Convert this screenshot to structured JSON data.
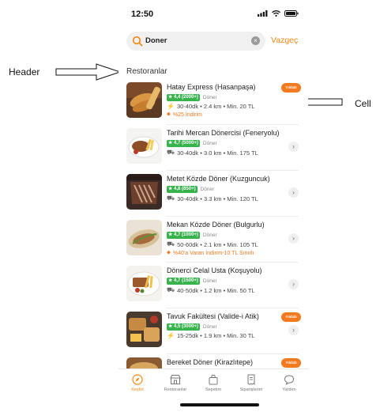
{
  "annotations": {
    "header_label": "Header",
    "cell_label": "Cell"
  },
  "status_bar": {
    "time": "12:50"
  },
  "search": {
    "query": "Doner",
    "cancel_label": "Vazgeç"
  },
  "section_title": "Restoranlar",
  "restaurants": [
    {
      "name": "Hatay Express (Hasanpaşa)",
      "rating": "4,4 (2000+)",
      "cuisine": "Döner",
      "details": "30-40dk • 2.4 km • Min. 20 TL",
      "promo": "%25 İndirim",
      "has_badge": true,
      "badge_text": "Yıldızlı"
    },
    {
      "name": "Tarihi Mercan Dönercisi (Feneryolu)",
      "rating": "4,7 (5000+)",
      "cuisine": "Döner",
      "details": "30-40dk • 3.0 km • Min. 175 TL",
      "promo": "",
      "has_badge": false,
      "badge_text": ""
    },
    {
      "name": "Metet Közde Döner (Kuzguncuk)",
      "rating": "4,8 (850+)",
      "cuisine": "Döner",
      "details": "30-40dk • 3.3 km • Min. 120 TL",
      "promo": "",
      "has_badge": false,
      "badge_text": ""
    },
    {
      "name": "Mekan Közde Döner (Bulgurlu)",
      "rating": "4,7 (1000+)",
      "cuisine": "Döner",
      "details": "50-60dk • 2.1 km • Min. 105 TL",
      "promo": "%40'a Varan İndirim-10 TL Sınırlı",
      "has_badge": false,
      "badge_text": ""
    },
    {
      "name": "Dönerci Celal Usta (Koşuyolu)",
      "rating": "4,7 (1500+)",
      "cuisine": "Döner",
      "details": "40-50dk • 1.2 km • Min. 50 TL",
      "promo": "",
      "has_badge": false,
      "badge_text": ""
    },
    {
      "name": "Tavuk Fakültesi (Valide-i Atik)",
      "rating": "4,5 (3000+)",
      "cuisine": "Döner",
      "details": "15-25dk • 1.9 km • Min. 30 TL",
      "promo": "",
      "has_badge": true,
      "badge_text": "Yıldızlı"
    },
    {
      "name": "Bereket Döner (Kirazlıtepe)",
      "rating": "",
      "cuisine": "",
      "details": "",
      "promo": "",
      "has_badge": true,
      "badge_text": "Yıldızlı"
    }
  ],
  "tabs": [
    {
      "label": "Keşfet",
      "icon": "compass-icon",
      "active": true
    },
    {
      "label": "Restoranlar",
      "icon": "restaurant-icon",
      "active": false
    },
    {
      "label": "Sepetim",
      "icon": "bag-icon",
      "active": false
    },
    {
      "label": "Siparişlerim",
      "icon": "receipt-icon",
      "active": false
    },
    {
      "label": "Yardım",
      "icon": "chat-icon",
      "active": false
    }
  ],
  "colors": {
    "accent": "#f08a17",
    "rating_green": "#37b24d",
    "promo_orange": "#f0791f"
  }
}
